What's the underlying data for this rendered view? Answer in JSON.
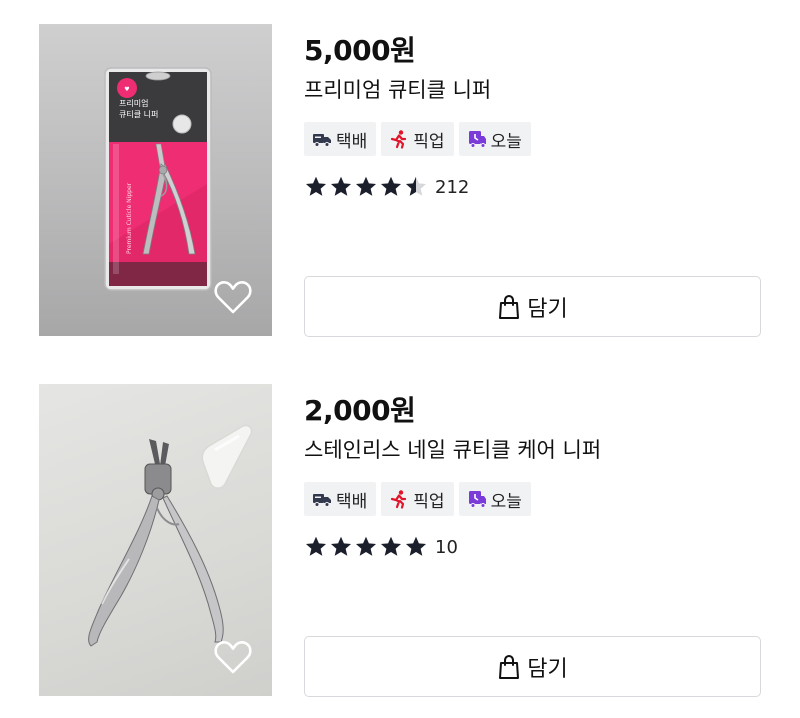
{
  "products": [
    {
      "price": "5,000원",
      "name": "프리미엄 큐티클 니퍼",
      "badges": [
        {
          "label": "택배",
          "icon": "delivery-truck-icon",
          "color": "#333a4d"
        },
        {
          "label": "픽업",
          "icon": "pickup-runner-icon",
          "color": "#e0142b"
        },
        {
          "label": "오늘",
          "icon": "today-delivery-icon",
          "color": "#7a3bd9"
        }
      ],
      "rating": 4.5,
      "review_count": "212",
      "cart_label": "담기",
      "package_text": {
        "title_line1": "프리미엄",
        "title_line2": "큐티클 니퍼",
        "side_text": "Premium Cuticle Nipper"
      }
    },
    {
      "price": "2,000원",
      "name": "스테인리스 네일 큐티클 케어 니퍼",
      "badges": [
        {
          "label": "택배",
          "icon": "delivery-truck-icon",
          "color": "#333a4d"
        },
        {
          "label": "픽업",
          "icon": "pickup-runner-icon",
          "color": "#e0142b"
        },
        {
          "label": "오늘",
          "icon": "today-delivery-icon",
          "color": "#7a3bd9"
        }
      ],
      "rating": 5,
      "review_count": "10",
      "cart_label": "담기"
    }
  ],
  "colors": {
    "star_filled": "#1b1f2b",
    "star_empty": "#d5d7db",
    "package_pink": "#ee2d72"
  }
}
